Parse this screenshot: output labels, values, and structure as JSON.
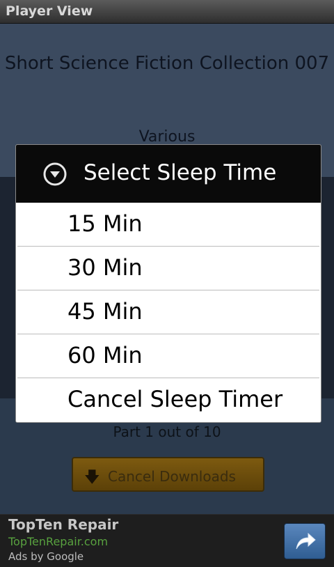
{
  "titlebar": {
    "title": "Player View"
  },
  "player": {
    "book_title": "Short Science Fiction Collection 007",
    "author": "Various",
    "part_text": "Part 1 out of 10",
    "cancel_downloads_label": "Cancel Downloads",
    "cancel_downloads_icon": "download-arrow-icon"
  },
  "dialog": {
    "title": "Select Sleep Time",
    "header_icon": "chevron-down-circle-icon",
    "options": [
      {
        "label": "15 Min"
      },
      {
        "label": "30 Min"
      },
      {
        "label": "45 Min"
      },
      {
        "label": "60 Min"
      },
      {
        "label": "Cancel Sleep Timer"
      }
    ]
  },
  "ad": {
    "title": "TopTen Repair",
    "url": "TopTenRepair.com",
    "by": "Ads by Google",
    "button_icon": "share-arrow-icon"
  }
}
